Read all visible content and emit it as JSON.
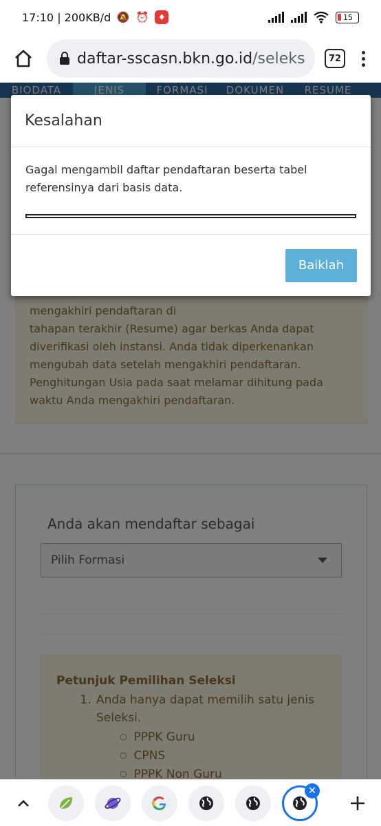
{
  "status_bar": {
    "time_speed": "17:10 | 200KB/d",
    "battery": "15"
  },
  "browser": {
    "url_host": "daftar-sscasn.bkn.go.id",
    "url_path": "/seleks",
    "tab_count": "72"
  },
  "tabs": [
    {
      "label": "BIODATA"
    },
    {
      "label": "JENIS"
    },
    {
      "label": "FORMASI"
    },
    {
      "label": "DOKUMEN"
    },
    {
      "label": "RESUME"
    }
  ],
  "warning": {
    "line1": "mengakhiri pendaftaran di",
    "line2": "tahapan terakhir (Resume) agar berkas Anda dapat diverifikasi oleh instansi. Anda tidak diperkenankan mengubah data setelah mengakhiri pendaftaran. Penghitungan Usia pada saat melamar dihitung pada waktu Anda mengakhiri pendaftaran."
  },
  "form": {
    "label": "Anda akan mendaftar sebagai",
    "select_value": "Pilih Formasi"
  },
  "guide": {
    "title": "Petunjuk Pemilihan Seleksi",
    "item1": "Anda hanya dapat memilih satu jenis Seleksi.",
    "options": [
      "PPPK Guru",
      "CPNS",
      "PPPK Non Guru"
    ]
  },
  "modal": {
    "title": "Kesalahan",
    "message": "Gagal mengambil daftar pendaftaran beserta tabel referensinya dari basis data.",
    "progress": 0,
    "ok_label": "Baiklah"
  },
  "bottom_bar": {
    "tabs": [
      "leaf-favicon",
      "planet-favicon",
      "google-favicon",
      "globe-favicon",
      "globe-favicon",
      "globe-favicon"
    ]
  }
}
